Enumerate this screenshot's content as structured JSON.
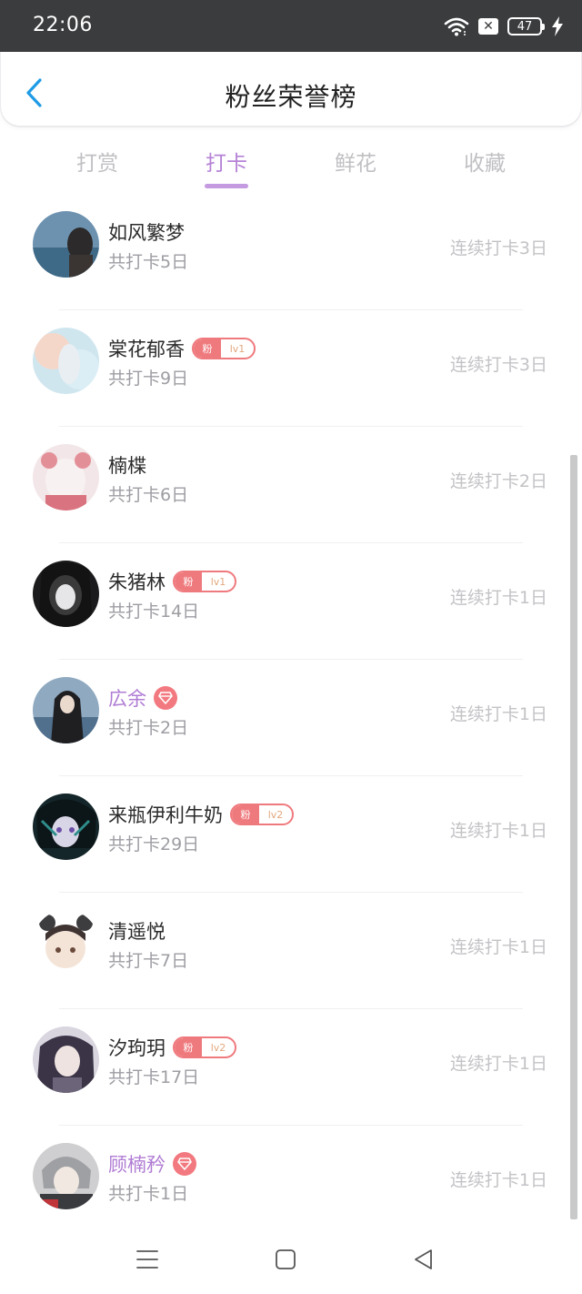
{
  "status_bar": {
    "time": "22:06",
    "battery": "47"
  },
  "header": {
    "title": "粉丝荣誉榜"
  },
  "tabs": [
    {
      "label": "打赏"
    },
    {
      "label": "打卡"
    },
    {
      "label": "鲜花"
    },
    {
      "label": "收藏"
    }
  ],
  "active_tab": "打卡",
  "fans": [
    {
      "name": "如风繁梦",
      "total": "共打卡5日",
      "streak": "连续打卡3日"
    },
    {
      "name": "棠花郁香",
      "badge": {
        "fan": "粉",
        "level": "lv1"
      },
      "total": "共打卡9日",
      "streak": "连续打卡3日"
    },
    {
      "name": "楠楪",
      "total": "共打卡6日",
      "streak": "连续打卡2日"
    },
    {
      "name": "朱猪林",
      "badge": {
        "fan": "粉",
        "level": "lv1"
      },
      "total": "共打卡14日",
      "streak": "连续打卡1日"
    },
    {
      "name": "広余",
      "vip": true,
      "total": "共打卡2日",
      "streak": "连续打卡1日"
    },
    {
      "name": "来瓶伊利牛奶",
      "badge": {
        "fan": "粉",
        "level": "lv2"
      },
      "total": "共打卡29日",
      "streak": "连续打卡1日"
    },
    {
      "name": "清遥悦",
      "total": "共打卡7日",
      "streak": "连续打卡1日"
    },
    {
      "name": "汐玽玥",
      "badge": {
        "fan": "粉",
        "level": "lv2"
      },
      "total": "共打卡17日",
      "streak": "连续打卡1日"
    },
    {
      "name": "顾楠矜",
      "vip": true,
      "total": "共打卡1日",
      "streak": "连续打卡1日"
    }
  ],
  "colors": {
    "accent": "#b582d6",
    "back_arrow": "#1e9be6",
    "fan_badge": "#ef7a7e"
  }
}
